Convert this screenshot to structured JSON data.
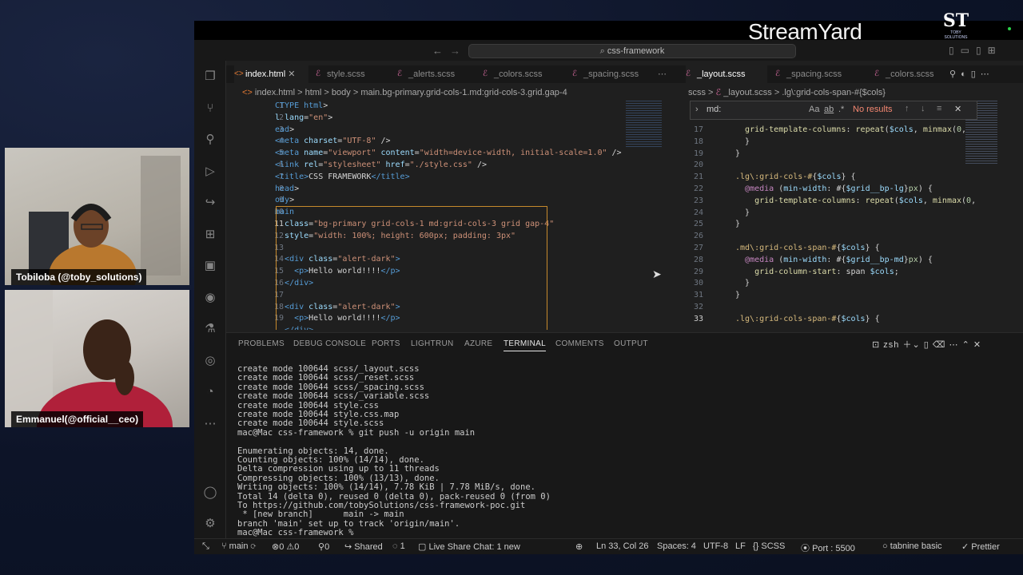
{
  "participants": [
    {
      "name": "Tobiloba (@toby_solutions)"
    },
    {
      "name": "Emmanuel(@official__ceo)"
    }
  ],
  "branding": {
    "stream_logo": "StreamYard",
    "company_logo": "ST",
    "company_sub": "TOBY SOLUTIONS"
  },
  "window": {
    "search_text": "css-framework"
  },
  "left_editor": {
    "tabs": [
      {
        "label": "index.html",
        "icon": "html-icon",
        "active": true
      },
      {
        "label": "style.scss",
        "icon": "scss-icon"
      },
      {
        "label": "_alerts.scss",
        "icon": "scss-icon"
      },
      {
        "label": "_colors.scss",
        "icon": "scss-icon"
      },
      {
        "label": "_spacing.scss",
        "icon": "scss-icon"
      }
    ],
    "breadcrumb": [
      "index.html",
      "html",
      "body",
      "main.bg-primary.grid-cols-1.md:grid-cols-3.grid.gap-4"
    ],
    "line_numbers": [
      "1",
      "2",
      "3",
      "4",
      "5",
      "6",
      "7",
      "8",
      "9",
      "10",
      "11",
      "12",
      "13",
      "14",
      "15",
      "16",
      "17",
      "18",
      "19"
    ]
  },
  "right_editor": {
    "tabs": [
      {
        "label": "_layout.scss",
        "icon": "scss-icon",
        "active": true
      },
      {
        "label": "_spacing.scss",
        "icon": "scss-icon"
      },
      {
        "label": "_colors.scss",
        "icon": "scss-icon"
      }
    ],
    "breadcrumb": [
      "scss",
      "_layout.scss",
      ".lg\\:grid-cols-span-#{$cols}"
    ],
    "find": {
      "query": "md:",
      "result": "No results",
      "aa": "Aa",
      "ab": "ab",
      "regex": ".*"
    },
    "line_numbers": [
      "17",
      "18",
      "19",
      "20",
      "21",
      "22",
      "23",
      "24",
      "25",
      "26",
      "27",
      "28",
      "29",
      "30",
      "31",
      "32",
      "33"
    ]
  },
  "panel": {
    "tabs": [
      "PROBLEMS",
      "DEBUG CONSOLE",
      "PORTS",
      "LIGHTRUN",
      "AZURE",
      "TERMINAL",
      "COMMENTS",
      "OUTPUT"
    ],
    "active_tab": "TERMINAL",
    "shell": "zsh",
    "terminal_lines": [
      "create mode 100644 scss/_layout.scss",
      "create mode 100644 scss/_reset.scss",
      "create mode 100644 scss/_spacing.scss",
      "create mode 100644 scss/_variable.scss",
      "create mode 100644 style.css",
      "create mode 100644 style.css.map",
      "create mode 100644 style.scss",
      "mac@Mac css-framework % git push -u origin main",
      "",
      "Enumerating objects: 14, done.",
      "Counting objects: 100% (14/14), done.",
      "Delta compression using up to 11 threads",
      "Compressing objects: 100% (13/13), done.",
      "Writing objects: 100% (14/14), 7.78 KiB | 7.78 MiB/s, done.",
      "Total 14 (delta 0), reused 0 (delta 0), pack-reused 0 (from 0)",
      "To https://github.com/tobySolutions/css-framework-poc.git",
      " * [new branch]      main -> main",
      "branch 'main' set up to track 'origin/main'.",
      "mac@Mac css-framework % "
    ]
  },
  "status": {
    "branch": "main",
    "errors": "0",
    "warnings": "0",
    "ports_forwarded": "0",
    "shared": "Shared",
    "users": "1",
    "live_share": "Live Share Chat: 1 new",
    "position": "Ln 33, Col 26",
    "spaces": "Spaces: 4",
    "encoding": "UTF-8",
    "eol": "LF",
    "language": "SCSS",
    "port": "Port : 5500",
    "tabnine": "tabnine basic",
    "prettier": "Prettier"
  }
}
